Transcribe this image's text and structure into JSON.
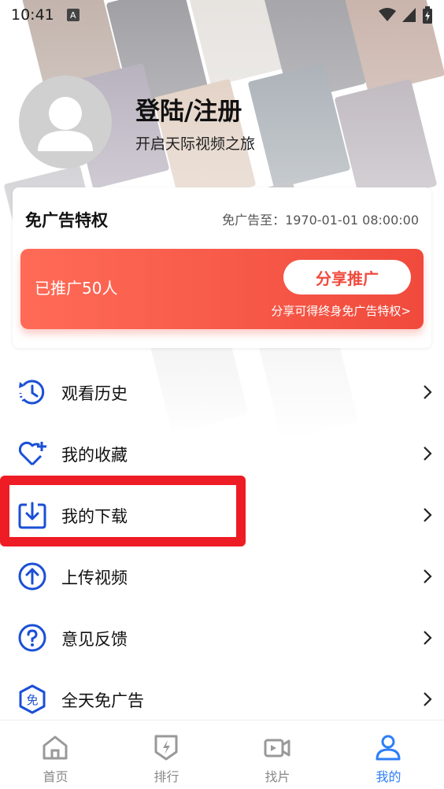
{
  "status_bar": {
    "time": "10:41",
    "indicator": "A",
    "icons": [
      "wifi-icon",
      "signal-icon",
      "battery-icon"
    ]
  },
  "profile": {
    "avatar_icon": "user-avatar-icon",
    "title": "登陆/注册",
    "subtitle": "开启天际视频之旅"
  },
  "ad_free_card": {
    "title": "免广告特权",
    "expire_text": "免广告至：1970-01-01 08:00:00",
    "promo": {
      "count_text": "已推广50人",
      "share_button": "分享推广",
      "hint": "分享可得终身免广告特权>"
    }
  },
  "menu": {
    "items": [
      {
        "label": "观看历史",
        "icon": "history-icon"
      },
      {
        "label": "我的收藏",
        "icon": "favorite-heart-icon"
      },
      {
        "label": "我的下载",
        "icon": "download-icon"
      },
      {
        "label": "上传视频",
        "icon": "upload-icon"
      },
      {
        "label": "意见反馈",
        "icon": "feedback-question-icon"
      },
      {
        "label": "全天免广告",
        "icon": "ad-free-icon"
      }
    ]
  },
  "bottom_nav": {
    "items": [
      {
        "label": "首页",
        "icon": "home-icon",
        "active": false
      },
      {
        "label": "排行",
        "icon": "ranking-icon",
        "active": false
      },
      {
        "label": "找片",
        "icon": "video-camera-icon",
        "active": false
      },
      {
        "label": "我的",
        "icon": "profile-icon",
        "active": true
      }
    ]
  },
  "colors": {
    "accent_blue": "#2d7ef7",
    "icon_blue": "#1a4fd6",
    "promo_red": "#f04a3c",
    "highlight_red": "#ee1c24"
  }
}
